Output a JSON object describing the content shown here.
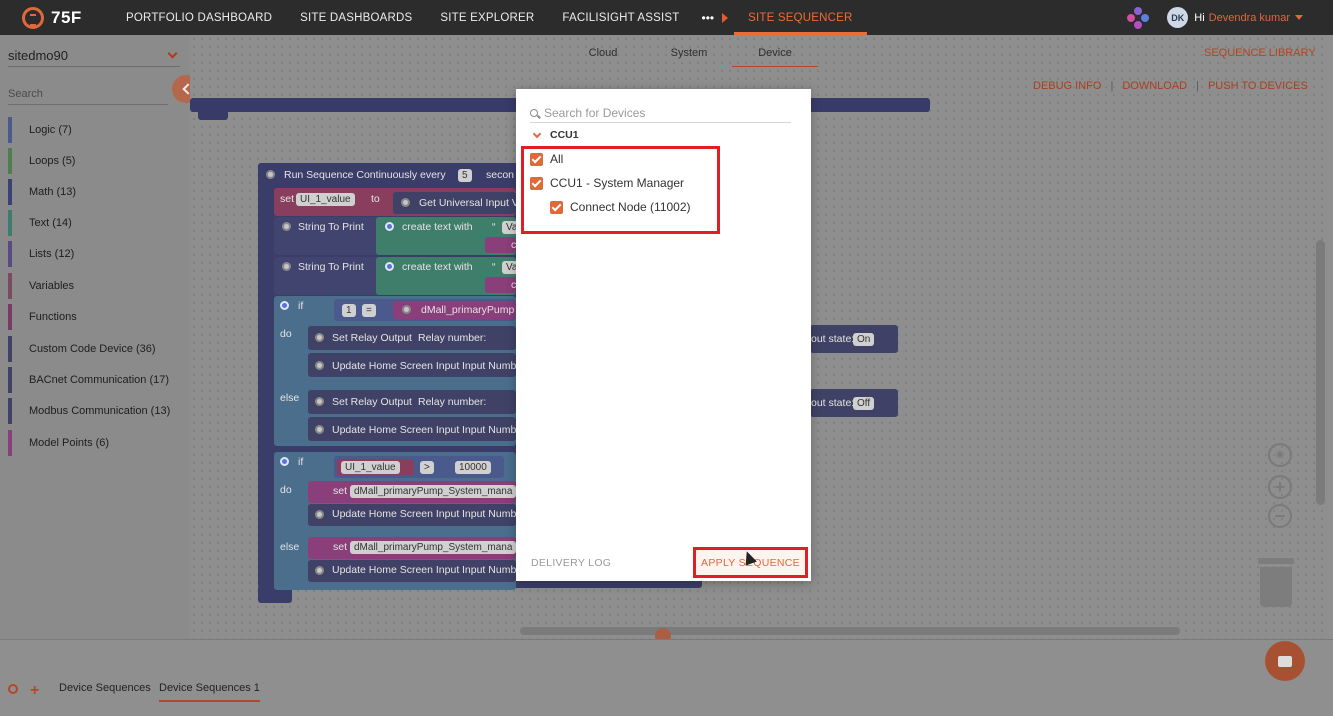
{
  "app": {
    "logo_text": "75F"
  },
  "nav": {
    "items": [
      "PORTFOLIO DASHBOARD",
      "SITE DASHBOARDS",
      "SITE EXPLORER",
      "FACILISIGHT ASSIST"
    ],
    "more": "•••",
    "active": "SITE SEQUENCER"
  },
  "user": {
    "initials": "DK",
    "greeting": "Hi",
    "name": "Devendra kumar"
  },
  "sidebar": {
    "site": "sitedmo90",
    "search_placeholder": "Search",
    "categories": [
      {
        "label": "Logic (7)",
        "color": "#4a5a8c"
      },
      {
        "label": "Loops (5)",
        "color": "#4e7d4e"
      },
      {
        "label": "Math (13)",
        "color": "#3d3f78"
      },
      {
        "label": "Text (14)",
        "color": "#3e7d6d"
      },
      {
        "label": "Lists (12)",
        "color": "#5b4a82"
      },
      {
        "label": "Variables",
        "color": "#7a4a62"
      },
      {
        "label": "Functions",
        "color": "#7a3a66"
      },
      {
        "label": "Custom Code Device (36)",
        "color": "#3f4266"
      },
      {
        "label": "BACnet Communication (17)",
        "color": "#3f4266"
      },
      {
        "label": "Modbus Communication (13)",
        "color": "#3f4266"
      },
      {
        "label": "Model Points (6)",
        "color": "#8a3e7a"
      }
    ]
  },
  "workspace": {
    "tabs": [
      "Cloud",
      "System",
      "Device"
    ],
    "active_tab": "Device",
    "sequence_library": "SEQUENCE LIBRARY",
    "links": [
      "DEBUG INFO",
      "DOWNLOAD",
      "PUSH TO DEVICES"
    ],
    "blocks": {
      "run_seq": "Run Sequence Continuously",
      "every": "every",
      "every_value": "5",
      "seconds": "secon",
      "set": "set",
      "var_ui1": "UI_1_value",
      "to": "to",
      "get_input": "Get Universal Input V",
      "string_to_print": "String To Print",
      "create_text": "create text with",
      "quote": "“",
      "va": "Va",
      "c": "c",
      "if": "if",
      "do": "do",
      "else": "else",
      "cmp_value": "1",
      "eq": "=",
      "dmall_pump": "dMall_primaryPump",
      "set_relay": "Set Relay Output",
      "relay_number": "Relay number:",
      "update_home": "Update Home Screen Input",
      "input_numb": "Input Numb",
      "out_state": "out state:",
      "state_on": "On",
      "state_off": "Off",
      "gt": ">",
      "threshold": "10000",
      "set_dmall": "dMall_primaryPump_System_mana"
    }
  },
  "modal": {
    "search_placeholder": "Search for Devices",
    "group": "CCU1",
    "options": [
      "All",
      "CCU1 - System Manager",
      "Connect Node (11002)"
    ],
    "delivery_log": "DELIVERY LOG",
    "apply": "APPLY SEQUENCE"
  },
  "bottom": {
    "tabs": [
      "Device Sequences",
      "Device Sequences 1"
    ],
    "active_tab": "Device Sequences 1"
  }
}
